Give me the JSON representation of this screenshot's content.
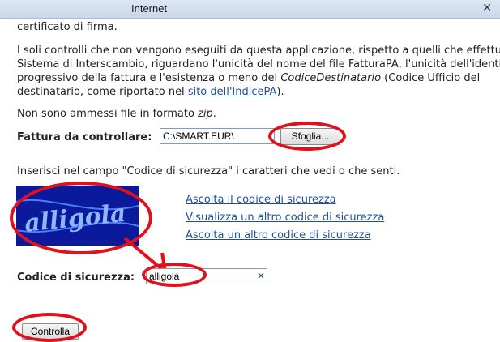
{
  "window": {
    "title": "Internet",
    "close_glyph": "✕"
  },
  "intro": {
    "line0": "certificato di firma.",
    "line1": "I soli controlli che non vengono eseguiti da questa applicazione, rispetto a quelli che effettua",
    "line2": "Sistema di Interscambio, riguardano l'unicità del nome del file FatturaPA, l'unicità dell'identif",
    "line3a": "progressivo della fattura e l'esistenza o meno del ",
    "line3b": "CodiceDestinatario",
    "line3c": " (Codice Ufficio del",
    "line4a": "destinatario, come riportato nel ",
    "line4link": "sito dell'IndicePA",
    "line4b": ").",
    "zip_a": "Non sono ammessi file in formato ",
    "zip_b": "zip",
    "zip_c": "."
  },
  "invoice": {
    "label": "Fattura da controllare:",
    "file_value": "C:\\SMART.EUR\\",
    "browse_button": "Sfoglia..."
  },
  "captcha": {
    "instruction": "Inserisci nel campo \"Codice di sicurezza\" i caratteri che vedi o che senti.",
    "image_text": "alligola",
    "links": [
      "Ascolta il codice di sicurezza",
      "Visualizza un altro codice di sicurezza",
      "Ascolta un altro codice di sicurezza"
    ],
    "field_label": "Codice di sicurezza:",
    "field_value": "alligola",
    "clear_glyph": "×"
  },
  "submit": {
    "label": "Controlla"
  },
  "colors": {
    "annotation": "#e0101c",
    "link": "#1f4f9c",
    "captcha_bg": "#0a1a9a"
  }
}
